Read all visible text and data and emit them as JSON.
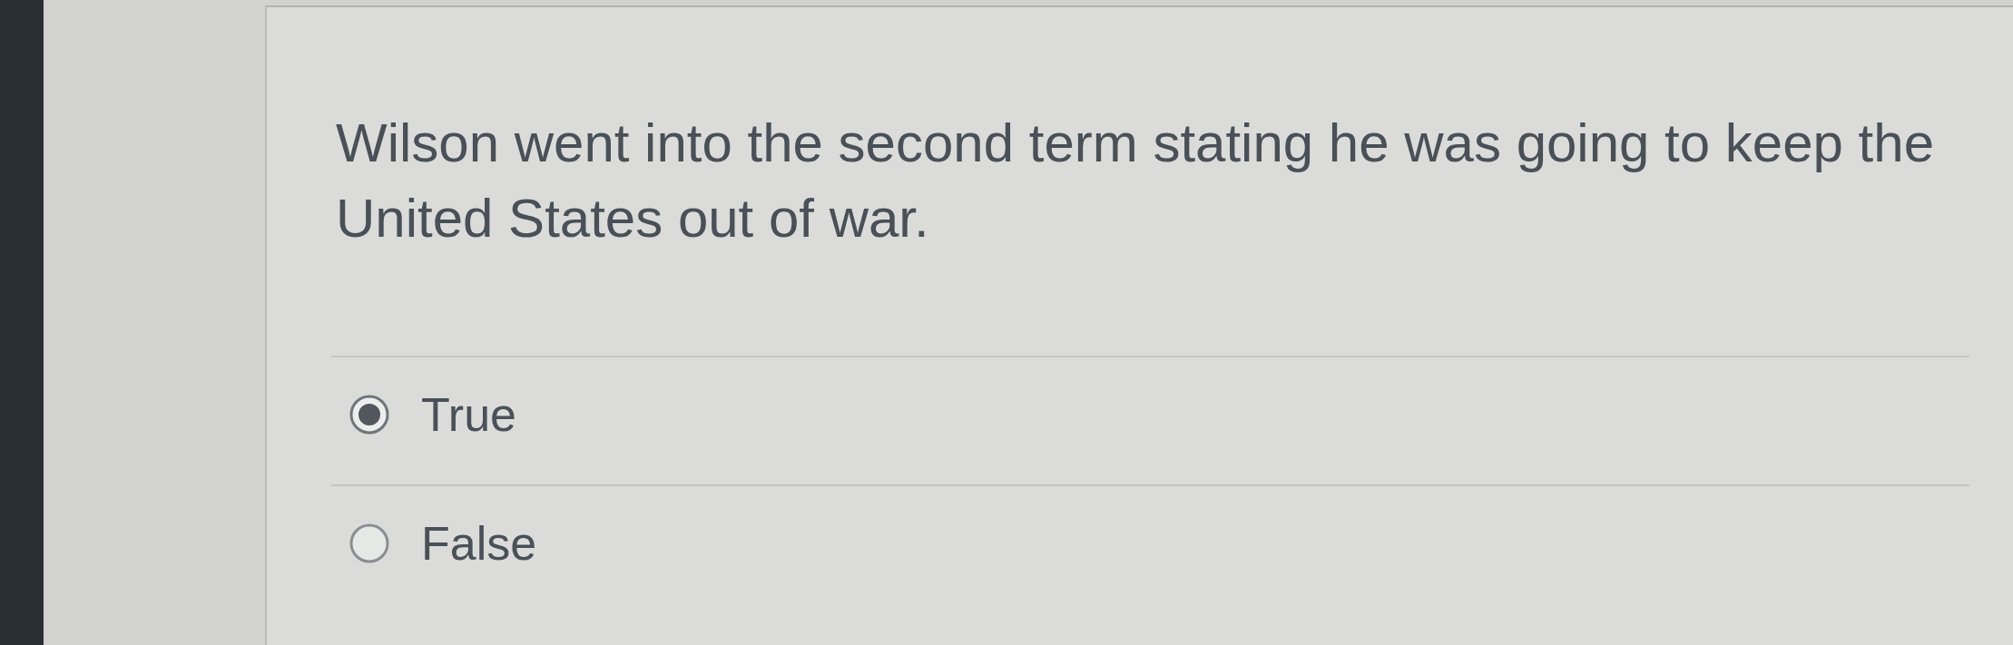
{
  "question": {
    "text": "Wilson went into the second term stating he was going to keep the United States out of war."
  },
  "options": [
    {
      "label": "True",
      "selected": true
    },
    {
      "label": "False",
      "selected": false
    }
  ]
}
